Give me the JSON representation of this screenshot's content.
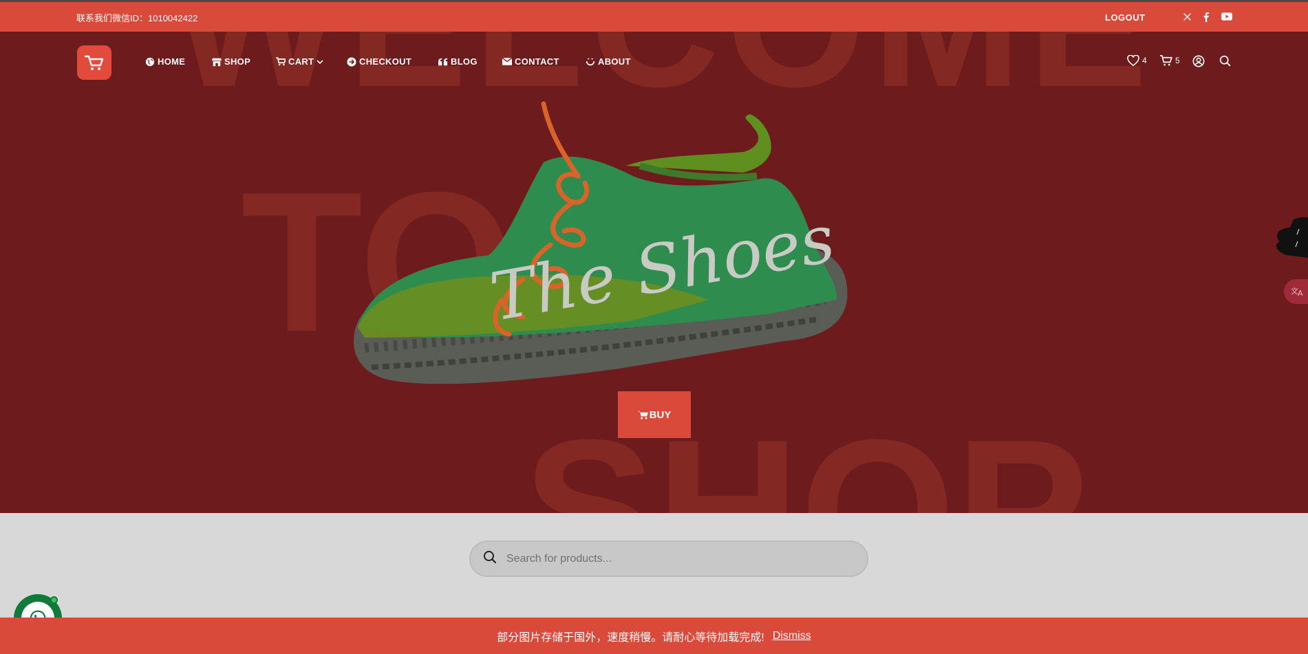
{
  "topbar": {
    "wechat_text": "联系我们微信ID：1010042422",
    "logout_label": "LOGOUT",
    "social": [
      {
        "name": "x-icon",
        "glyph": "𝕏"
      },
      {
        "name": "facebook-icon",
        "glyph": "f"
      },
      {
        "name": "youtube-icon",
        "glyph": "▶"
      }
    ]
  },
  "nav": {
    "items": [
      {
        "label": "HOME",
        "icon": "globe-icon"
      },
      {
        "label": "SHOP",
        "icon": "store-icon"
      },
      {
        "label": "CART",
        "icon": "cart-icon",
        "has_dropdown": true
      },
      {
        "label": "CHECKOUT",
        "icon": "arrow-circle-icon"
      },
      {
        "label": "BLOG",
        "icon": "quote-icon"
      },
      {
        "label": "CONTACT",
        "icon": "envelope-icon"
      },
      {
        "label": "ABOUT",
        "icon": "smile-icon"
      }
    ],
    "wishlist_count": "4",
    "cart_count": "5"
  },
  "hero": {
    "ghost_words": [
      "WELCOME",
      "TO",
      "SHOP"
    ],
    "script_text": "The Shoes",
    "buy_label": "BUY"
  },
  "search": {
    "placeholder": "Search for products..."
  },
  "notice": {
    "text": "部分图片存储于国外，速度稍慢。请耐心等待加载完成!",
    "dismiss_label": "Dismiss"
  },
  "colors": {
    "accent": "#d94a3b",
    "hero_bg": "#6e1b1e",
    "whatsapp": "#107a3a"
  }
}
